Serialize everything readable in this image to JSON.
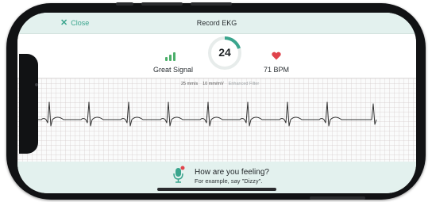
{
  "header": {
    "close_label": "Close",
    "title": "Record EKG"
  },
  "stats": {
    "signal_label": "Great Signal",
    "timer_value": "24",
    "timer_progress": 0.2,
    "bpm_label": "71 BPM"
  },
  "ecg": {
    "speed": "25 mm/s",
    "gain": "10 mm/mV",
    "filter": "Enhanced Filter",
    "beat_count": 8
  },
  "prompt": {
    "title": "How are you feeling?",
    "subtitle": "For example, say \"Dizzy\"."
  },
  "colors": {
    "accent": "#3aa58d",
    "header_bg": "#e3f1ee",
    "signal": "#4caf6a",
    "heart": "#e0434b",
    "trace": "#333333"
  },
  "icons": {
    "close": "close-icon",
    "signal": "signal-strength-icon",
    "heart": "heart-icon",
    "mic": "microphone-icon"
  }
}
